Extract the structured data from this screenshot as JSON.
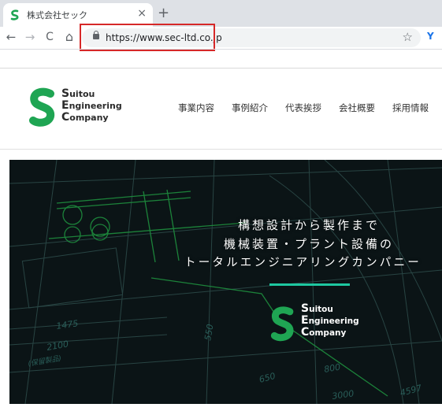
{
  "browser": {
    "tab_title": "株式会社セック",
    "close_glyph": "×",
    "newtab_glyph": "+",
    "url": "https://www.sec-ltd.co.jp",
    "back_glyph": "←",
    "forward_glyph": "→",
    "reload_glyph": "C",
    "home_glyph": "⌂",
    "star_glyph": "☆",
    "extension_glyph": "Y"
  },
  "site": {
    "logo": {
      "line1_cap": "S",
      "line1_rest": "uitou",
      "line2_cap": "E",
      "line2_rest": "ngineering",
      "line3_cap": "C",
      "line3_rest": "ompany"
    },
    "nav": [
      "事業内容",
      "事例紹介",
      "代表挨拶",
      "会社概要",
      "採用情報"
    ],
    "hero": {
      "line1": "構想設計から製作まで",
      "line2": "機械装置・プラント設備の",
      "line3": "トータルエンジニアリングカンパニー"
    },
    "brand_green": "#1fa553",
    "accent_teal": "#1ec8a0"
  }
}
